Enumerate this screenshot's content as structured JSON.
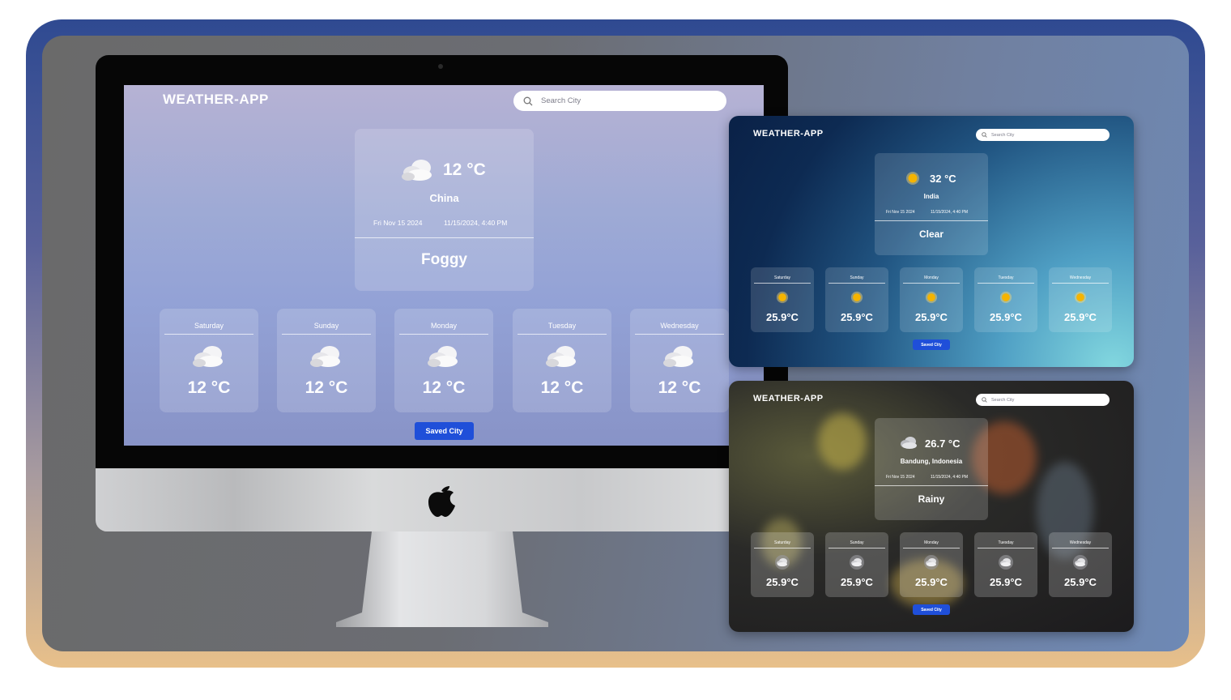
{
  "desktop": {
    "app_title": "WEATHER-APP",
    "search_placeholder": "Search City",
    "current": {
      "temp": "12 °C",
      "location": "China",
      "date": "Fri Nov 15 2024",
      "datetime": "11/15/2024, 4:40 PM",
      "condition": "Foggy",
      "icon": "cloud-icon"
    },
    "forecast": [
      {
        "day": "Saturday",
        "temp": "12 °C",
        "icon": "cloud-icon"
      },
      {
        "day": "Sunday",
        "temp": "12 °C",
        "icon": "cloud-icon"
      },
      {
        "day": "Monday",
        "temp": "12 °C",
        "icon": "cloud-icon"
      },
      {
        "day": "Tuesday",
        "temp": "12 °C",
        "icon": "cloud-icon"
      },
      {
        "day": "Wednesday",
        "temp": "12 °C",
        "icon": "cloud-icon"
      }
    ],
    "saved_city_label": "Saved City"
  },
  "clear_view": {
    "app_title": "WEATHER-APP",
    "search_placeholder": "Search City",
    "current": {
      "temp": "32 °C",
      "location": "India",
      "date": "Fri Nov 15 2024",
      "datetime": "11/15/2024, 4:40 PM",
      "condition": "Clear",
      "icon": "sun-icon"
    },
    "forecast": [
      {
        "day": "Saturday",
        "temp": "25.9°C",
        "icon": "sun-icon"
      },
      {
        "day": "Sunday",
        "temp": "25.9°C",
        "icon": "sun-icon"
      },
      {
        "day": "Monday",
        "temp": "25.9°C",
        "icon": "sun-icon"
      },
      {
        "day": "Tuesday",
        "temp": "25.9°C",
        "icon": "sun-icon"
      },
      {
        "day": "Wednesday",
        "temp": "25.9°C",
        "icon": "sun-icon"
      }
    ],
    "saved_city_label": "Saved City"
  },
  "rainy_view": {
    "app_title": "WEATHER-APP",
    "search_placeholder": "Search City",
    "current": {
      "temp": "26.7 °C",
      "location": "Bandung, Indonesia",
      "date": "Fri Nov 15 2024",
      "datetime": "11/15/2024, 4:40 PM",
      "condition": "Rainy",
      "icon": "rain-cloud-icon"
    },
    "forecast": [
      {
        "day": "Saturday",
        "temp": "25.9°C",
        "icon": "rain-cloud-icon"
      },
      {
        "day": "Sunday",
        "temp": "25.9°C",
        "icon": "rain-cloud-icon"
      },
      {
        "day": "Monday",
        "temp": "25.9°C",
        "icon": "rain-cloud-icon"
      },
      {
        "day": "Tuesday",
        "temp": "25.9°C",
        "icon": "rain-cloud-icon"
      },
      {
        "day": "Wednesday",
        "temp": "25.9°C",
        "icon": "rain-cloud-icon"
      }
    ],
    "saved_city_label": "Saved City"
  },
  "colors": {
    "button_blue": "#1f4fd9",
    "sun_yellow": "#f5b400"
  }
}
